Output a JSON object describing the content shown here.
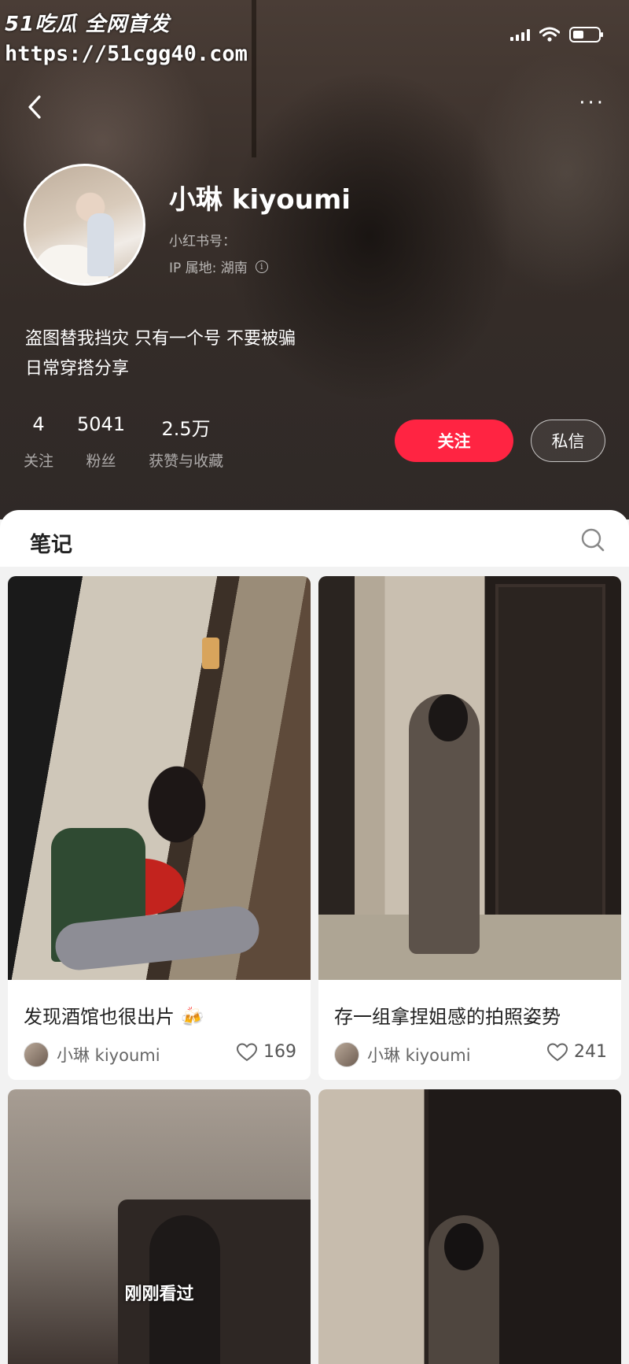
{
  "watermark": {
    "brand": "51吃瓜 全网首发",
    "url": "https://51cgg40.com"
  },
  "nav": {
    "back_icon": "chevron-left-icon",
    "more_icon": "more-dots-icon"
  },
  "profile": {
    "nickname": "小琳 kiyoumi",
    "red_id_label": "小红书号：",
    "ip_location": "IP 属地: 湖南",
    "bio_lines": [
      "盗图替我挡灾 只有一个号 不要被骗",
      "日常穿搭分享"
    ],
    "stats": [
      {
        "value": "4",
        "label": "关注"
      },
      {
        "value": "5041",
        "label": "粉丝"
      },
      {
        "value": "2.5万",
        "label": "获赞与收藏"
      }
    ],
    "follow_label": "关注",
    "message_label": "私信"
  },
  "tabs": {
    "notes_label": "笔记"
  },
  "notes": [
    {
      "title": "发现酒馆也很出片 🍻",
      "author": "小琳 kiyoumi",
      "likes": "169"
    },
    {
      "title": "存一组拿捏姐感的拍照姿势",
      "author": "小琳 kiyoumi",
      "likes": "241"
    },
    {
      "overlay": "刚刚看过"
    },
    {}
  ],
  "colors": {
    "accent": "#ff2442",
    "header_bg": "#342c28",
    "page_bg": "#f2f2f2"
  }
}
